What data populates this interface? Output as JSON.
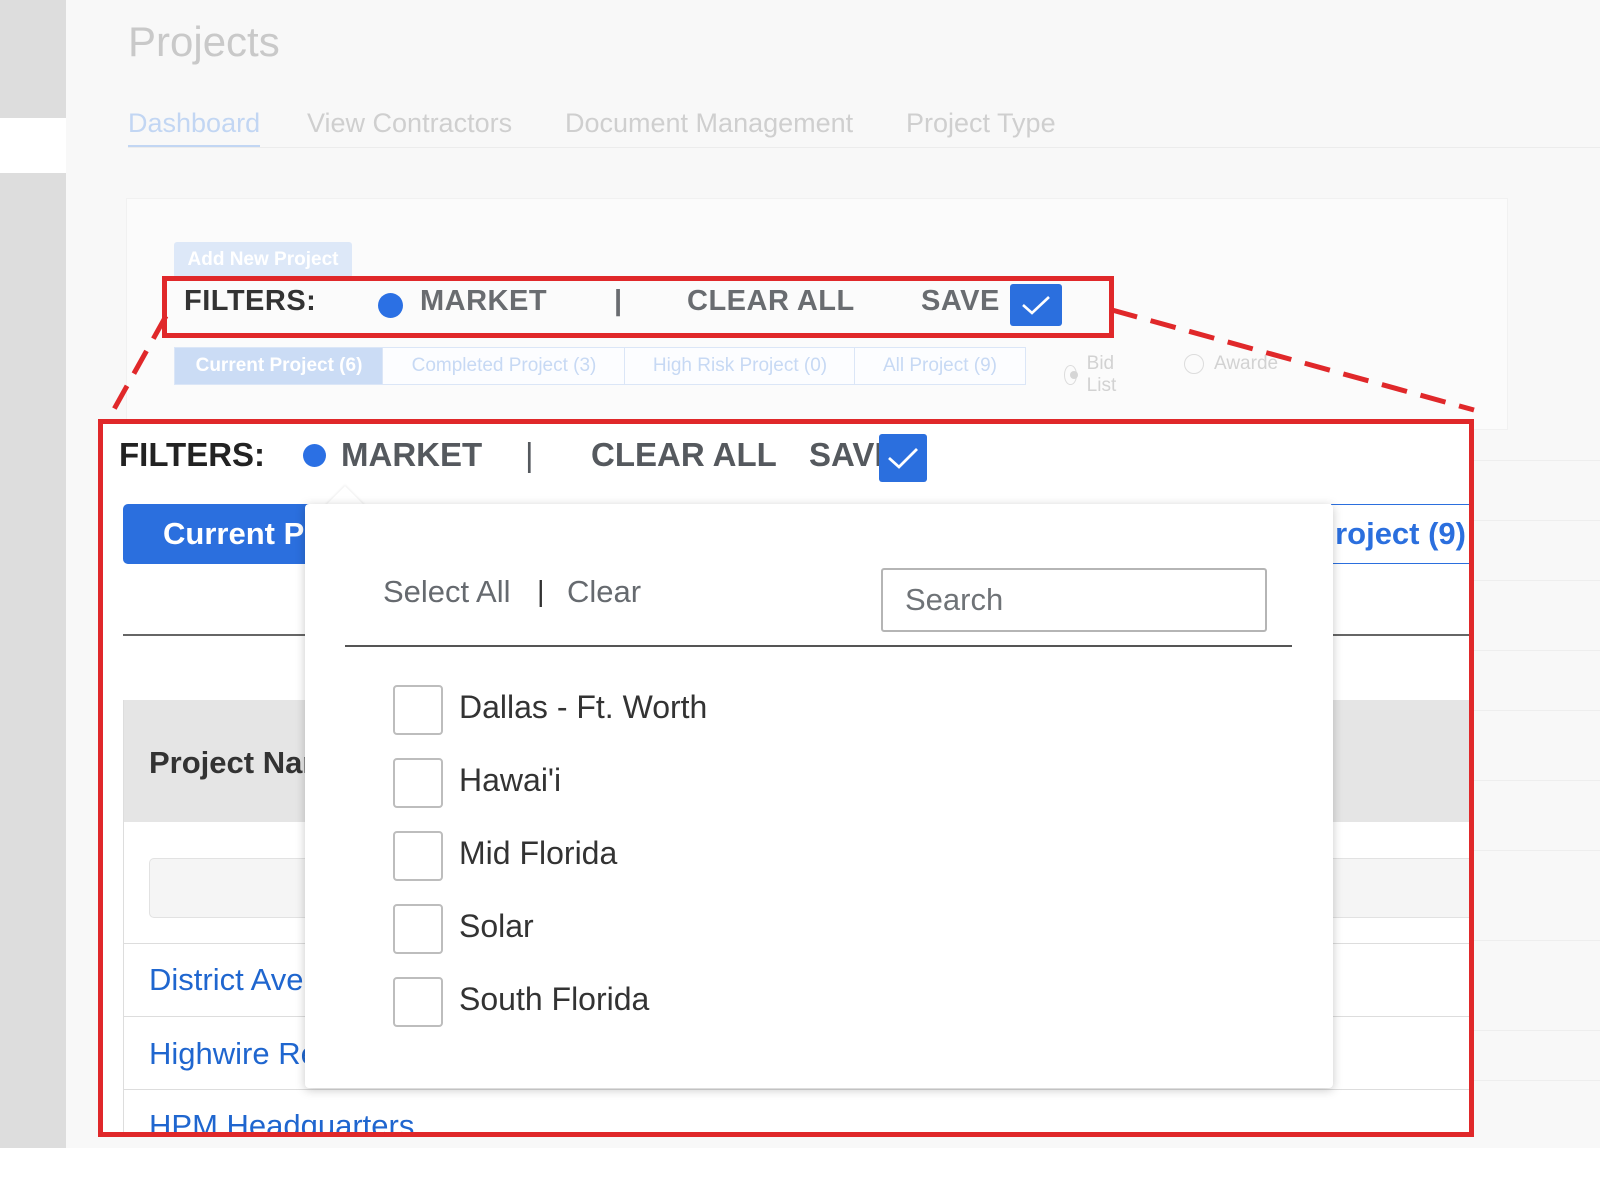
{
  "page": {
    "title": "Projects",
    "tabs": [
      "Dashboard",
      "View Contractors",
      "Document Management",
      "Project Type"
    ],
    "add_button": "Add New Project"
  },
  "filters": {
    "label": "FILTERS:",
    "market": "MARKET",
    "separator": "|",
    "clear_all": "CLEAR ALL",
    "save": "SAVE"
  },
  "project_tabs": {
    "current": "Current Project (6)",
    "completed": "Completed Project (3)",
    "high_risk": "High Risk Project (0)",
    "all": "All Project (9)",
    "zoom_current": "Current Pr",
    "zoom_all": "roject (9)"
  },
  "list_view": {
    "bid_list": "Bid List",
    "awarded": "Awarde"
  },
  "table": {
    "header_project_name": "Project Nar",
    "rows": [
      "District Ave",
      "Highwire Re",
      "HPM Headquarters"
    ]
  },
  "market_dropdown": {
    "select_all": "Select All",
    "separator": "|",
    "clear": "Clear",
    "search_placeholder": "Search",
    "options": [
      "Dallas - Ft. Worth",
      "Hawai'i",
      "Mid Florida",
      "Solar",
      "South Florida"
    ]
  },
  "colors": {
    "primary": "#2b6fde",
    "highlight": "#e0282a",
    "link": "#1f66cf"
  }
}
